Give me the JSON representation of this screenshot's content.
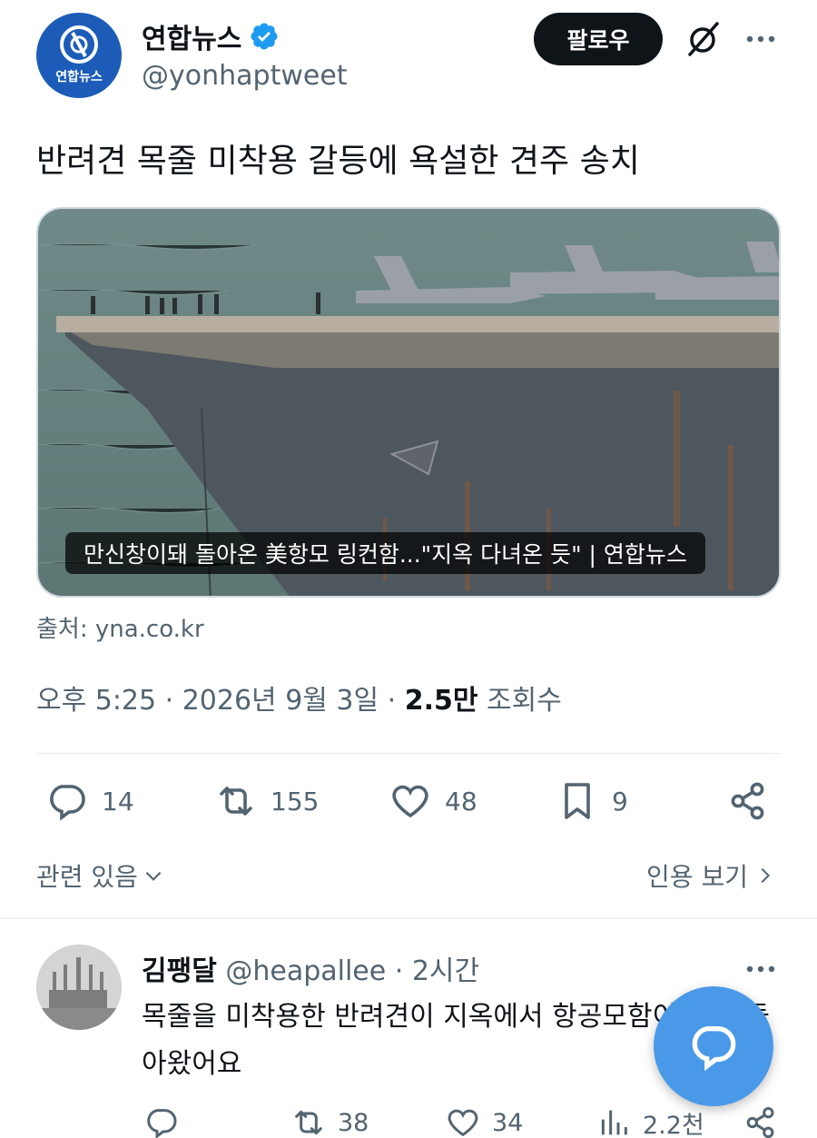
{
  "author": {
    "name": "연합뉴스",
    "handle": "@yonhaptweet",
    "avatar_text": "연합뉴스",
    "verified": true
  },
  "header": {
    "follow_label": "팔로우",
    "grok_icon": "grok-icon",
    "more_icon": "more-icon"
  },
  "tweet": {
    "text": "반려견 목줄 미착용 갈등에 욕설한 견주 송치",
    "card_caption": "만신창이돼 돌아온 美항모 링컨함...\"지옥 다녀온 듯\" | 연합뉴스",
    "source": "출처: yna.co.kr",
    "time": "오후 5:25 · 2026년 9월 3일 · ",
    "views_count": "2.5만",
    "views_label": " 조회수"
  },
  "actions": {
    "replies": "14",
    "retweets": "155",
    "likes": "48",
    "bookmarks": "9"
  },
  "links": {
    "related": "관련 있음",
    "quotes": "인용 보기"
  },
  "reply": {
    "name": "김팽달",
    "handle": "@heapallee · 2시간",
    "text": "목줄을 미착용한 반려견이 지옥에서 항공모함이 되어 돌아왔어요",
    "retweets": "38",
    "likes": "34",
    "views": "2.2천"
  },
  "colors": {
    "accent": "#1d9bf0",
    "fab": "#4a99e9",
    "muted": "#536471",
    "text": "#0f1419"
  }
}
